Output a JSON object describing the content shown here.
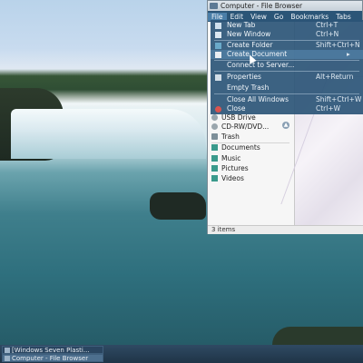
{
  "window": {
    "title": "Computer - File Browser",
    "menubar": [
      "File",
      "Edit",
      "View",
      "Go",
      "Bookmarks",
      "Tabs"
    ],
    "status": "3 items"
  },
  "sidebar": {
    "devices": [
      {
        "label": "USB Drive",
        "icon": "usb-drive-icon"
      },
      {
        "label": "CD-RW/DVD...",
        "icon": "cd-drive-icon"
      },
      {
        "label": "Trash",
        "icon": "trash-icon"
      }
    ],
    "bookmarks": [
      {
        "label": "Documents",
        "icon": "folder-icon"
      },
      {
        "label": "Music",
        "icon": "folder-icon"
      },
      {
        "label": "Pictures",
        "icon": "folder-icon"
      },
      {
        "label": "Videos",
        "icon": "folder-icon"
      }
    ]
  },
  "file_menu": {
    "items": [
      {
        "label": "New Tab",
        "accel": "Ctrl+T"
      },
      {
        "label": "New Window",
        "accel": "Ctrl+N"
      },
      {
        "label": "Create Folder",
        "accel": "Shift+Ctrl+N"
      },
      {
        "label": "Create Document",
        "accel": ""
      },
      {
        "label": "Connect to Server...",
        "accel": ""
      },
      {
        "label": "Properties",
        "accel": "Alt+Return"
      },
      {
        "label": "Empty Trash",
        "accel": ""
      },
      {
        "label": "Close All Windows",
        "accel": "Shift+Ctrl+W"
      },
      {
        "label": "Close",
        "accel": "Ctrl+W"
      }
    ]
  },
  "taskbar": {
    "tasks": [
      "[Windows Seven Plasti...",
      "Computer - File Browser"
    ]
  },
  "colors": {
    "menu_bg": "#2b5577",
    "panel_bg": "#1f3447"
  }
}
